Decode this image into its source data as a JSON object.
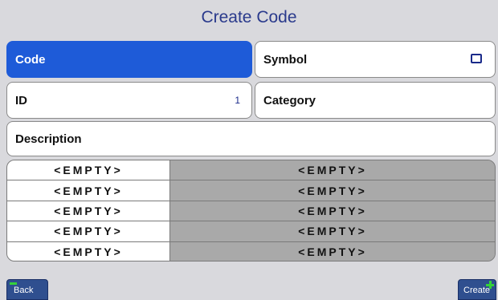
{
  "title": "Create Code",
  "fields": {
    "code": {
      "label": "Code"
    },
    "symbol": {
      "label": "Symbol"
    },
    "id": {
      "label": "ID",
      "value": "1"
    },
    "category": {
      "label": "Category"
    },
    "description": {
      "label": "Description"
    }
  },
  "table": {
    "rows": [
      {
        "left": "<EMPTY>",
        "right": "<EMPTY>"
      },
      {
        "left": "<EMPTY>",
        "right": "<EMPTY>"
      },
      {
        "left": "<EMPTY>",
        "right": "<EMPTY>"
      },
      {
        "left": "<EMPTY>",
        "right": "<EMPTY>"
      },
      {
        "left": "<EMPTY>",
        "right": "<EMPTY>"
      }
    ]
  },
  "buttons": {
    "back": "Back",
    "create": "Create"
  },
  "colors": {
    "accent": "#1e5bd8",
    "title": "#2a3a8c",
    "button": "#2f4f8f",
    "indicator": "#35d13a"
  },
  "icons": {
    "symbol_checkbox": "checkbox-icon",
    "back": "minus-icon",
    "create": "plus-icon"
  }
}
